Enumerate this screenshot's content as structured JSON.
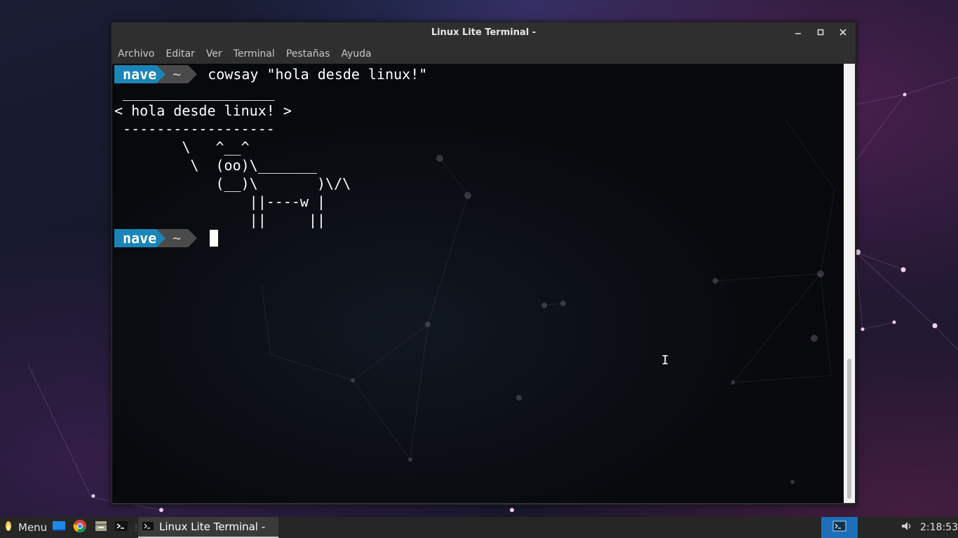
{
  "window": {
    "title": "Linux Lite Terminal -",
    "controls": {
      "minimize": "–",
      "maximize": "□",
      "close": "✕"
    }
  },
  "menubar": [
    "Archivo",
    "Editar",
    "Ver",
    "Terminal",
    "Pestañas",
    "Ayuda"
  ],
  "terminal": {
    "prompt_user": "nave",
    "prompt_dir": "~",
    "command": "cowsay \"hola desde linux!\"",
    "output": [
      " __________________",
      "< hola desde linux! >",
      " ------------------",
      "        \\   ^__^",
      "         \\  (oo)\\_______",
      "            (__)\\       )\\/\\",
      "                ||----w |",
      "                ||     ||"
    ]
  },
  "taskbar": {
    "menu_label": "Menu",
    "window_label": "Linux Lite Terminal -",
    "clock": "2:18:53",
    "launchers": [
      "desktop-icon",
      "chrome-icon",
      "files-icon",
      "terminal-icon"
    ]
  },
  "colors": {
    "prompt_user_bg": "#1b85b8",
    "prompt_dir_bg": "#4a4a4a",
    "workspace_active": "#1d6fb8"
  }
}
